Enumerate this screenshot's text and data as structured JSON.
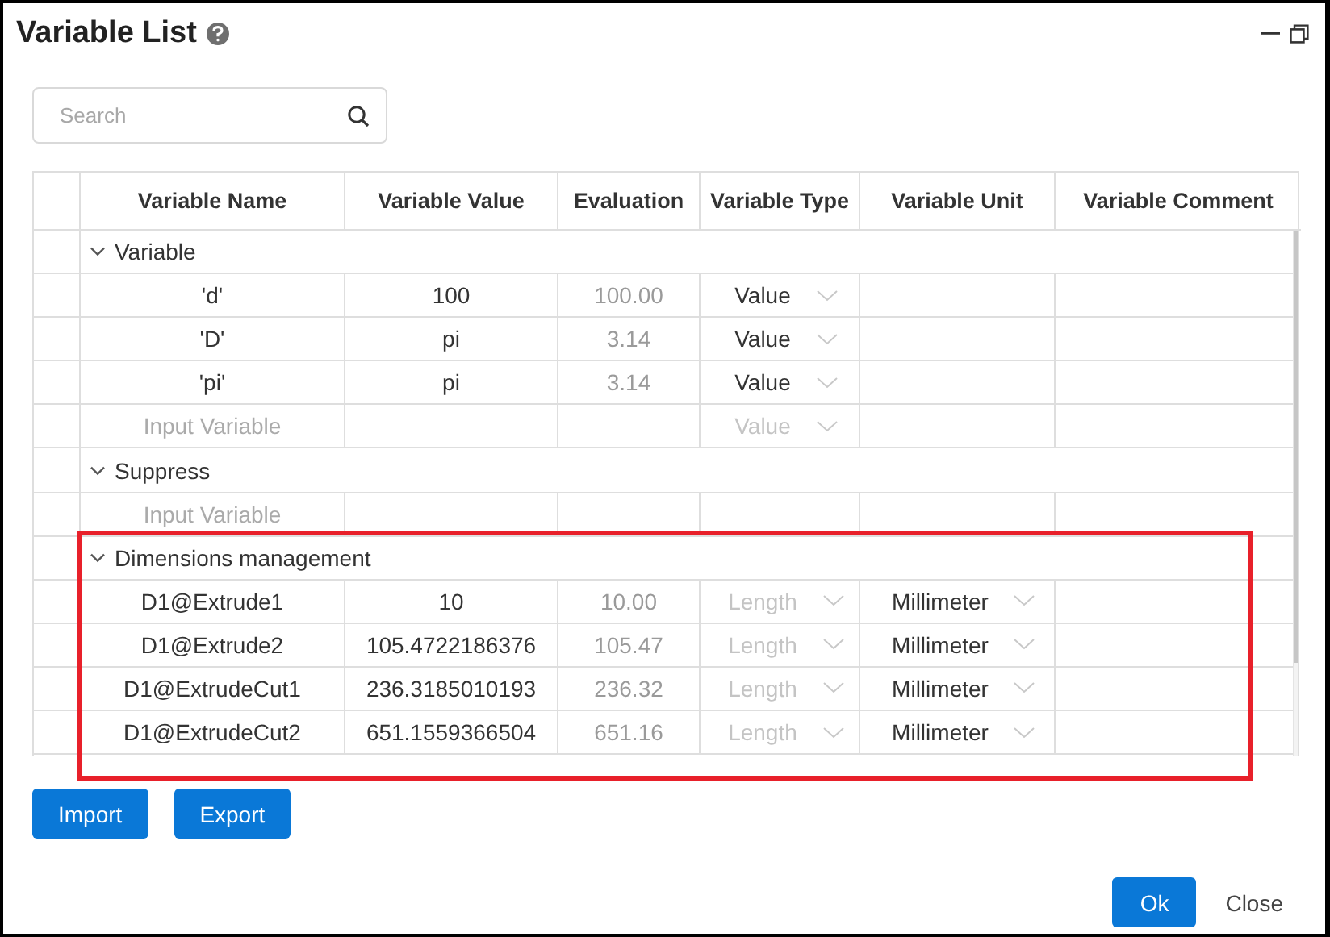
{
  "window": {
    "title": "Variable List"
  },
  "search": {
    "placeholder": "Search"
  },
  "table": {
    "columns": [
      "Variable Name",
      "Variable Value",
      "Evaluation",
      "Variable Type",
      "Variable Unit",
      "Variable Comment"
    ],
    "groups": [
      {
        "label": "Variable",
        "expanded": true,
        "rows": [
          {
            "kind": "variable",
            "name": "'d'",
            "value": "100",
            "evaluation": "100.00",
            "type": {
              "text": "Value",
              "disabled": false
            }
          },
          {
            "kind": "variable",
            "name": "'D'",
            "value": "pi",
            "evaluation": "3.14",
            "type": {
              "text": "Value",
              "disabled": false
            }
          },
          {
            "kind": "variable",
            "name": "'pi'",
            "value": "pi",
            "evaluation": "3.14",
            "type": {
              "text": "Value",
              "disabled": false
            }
          },
          {
            "kind": "input",
            "placeholder": "Input Variable",
            "type": {
              "text": "Value",
              "disabled": true
            }
          }
        ]
      },
      {
        "label": "Suppress",
        "expanded": true,
        "rows": [
          {
            "kind": "input",
            "placeholder": "Input Variable"
          }
        ]
      },
      {
        "label": "Dimensions management",
        "expanded": true,
        "rows": [
          {
            "kind": "variable",
            "name": "D1@Extrude1",
            "value": "10",
            "evaluation": "10.00",
            "type": {
              "text": "Length",
              "disabled": true
            },
            "unit": "Millimeter"
          },
          {
            "kind": "variable",
            "name": "D1@Extrude2",
            "value": "105.4722186376",
            "evaluation": "105.47",
            "type": {
              "text": "Length",
              "disabled": true
            },
            "unit": "Millimeter"
          },
          {
            "kind": "variable",
            "name": "D1@ExtrudeCut1",
            "value": "236.3185010193",
            "evaluation": "236.32",
            "type": {
              "text": "Length",
              "disabled": true
            },
            "unit": "Millimeter"
          },
          {
            "kind": "variable",
            "name": "D1@ExtrudeCut2",
            "value": "651.1559366504",
            "evaluation": "651.16",
            "type": {
              "text": "Length",
              "disabled": true
            },
            "unit": "Millimeter"
          }
        ]
      }
    ]
  },
  "actions": [
    {
      "label": "Import"
    },
    {
      "label": "Export"
    }
  ],
  "footer": [
    {
      "label": "Ok",
      "kind": "primary"
    },
    {
      "label": "Close",
      "kind": "plain"
    }
  ]
}
